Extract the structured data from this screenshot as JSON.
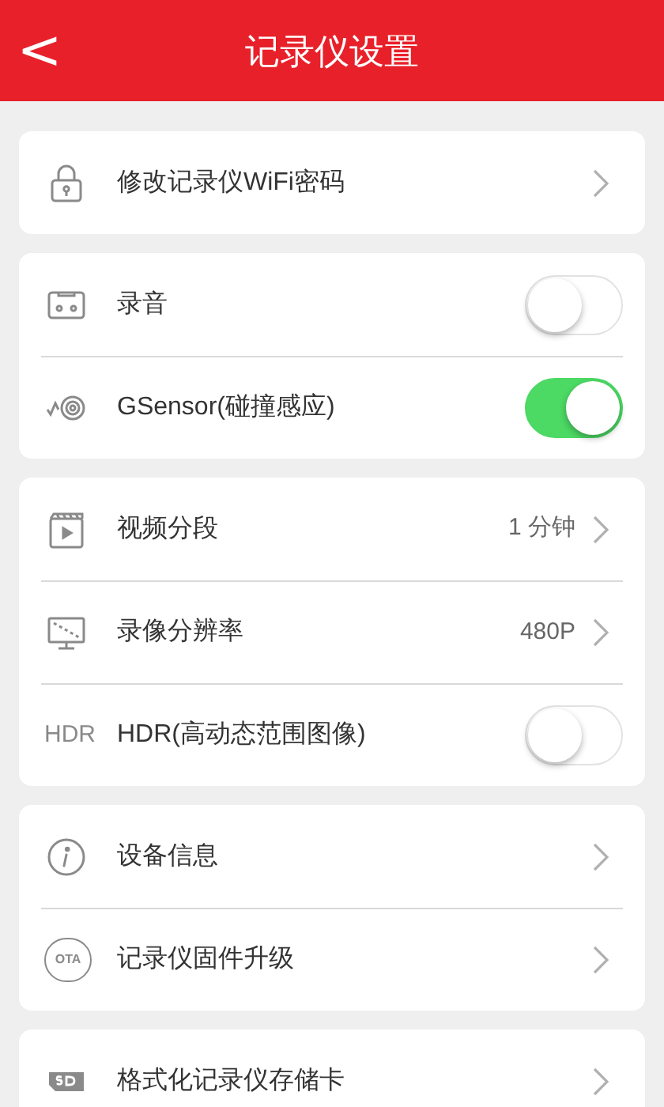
{
  "header": {
    "back": "<",
    "title": "记录仪设置"
  },
  "groups": [
    {
      "rows": [
        {
          "kind": "link",
          "label": "修改记录仪WiFi密码"
        }
      ]
    },
    {
      "rows": [
        {
          "kind": "toggle",
          "label": "录音",
          "on": false
        },
        {
          "kind": "toggle",
          "label": "GSensor(碰撞感应)",
          "on": true
        }
      ]
    },
    {
      "rows": [
        {
          "kind": "link",
          "label": "视频分段",
          "value": "1 分钟"
        },
        {
          "kind": "link",
          "label": "录像分辨率",
          "value": "480P"
        },
        {
          "kind": "toggle",
          "label": "HDR(高动态范围图像)",
          "on": false,
          "icon_text": "HDR"
        }
      ]
    },
    {
      "rows": [
        {
          "kind": "link",
          "label": "设备信息"
        },
        {
          "kind": "link",
          "label": "记录仪固件升级",
          "icon_text": "OTA"
        }
      ]
    },
    {
      "rows": [
        {
          "kind": "link",
          "label": "格式化记录仪存储卡"
        }
      ]
    }
  ]
}
